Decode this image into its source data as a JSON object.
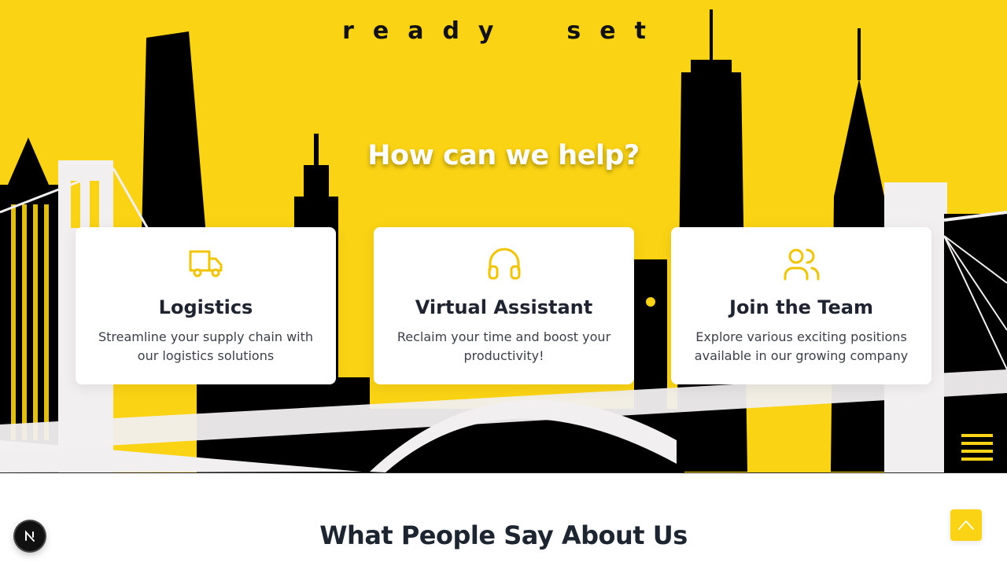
{
  "brand": {
    "logo_text": "ready  set"
  },
  "hero": {
    "title": "How can we help?"
  },
  "colors": {
    "accent": "#fad314",
    "dark": "#111111",
    "card_text": "#3b3f47"
  },
  "services": [
    {
      "icon": "truck-icon",
      "title": "Logistics",
      "description": "Streamline your supply chain with our logistics solutions"
    },
    {
      "icon": "headphones-icon",
      "title": "Virtual Assistant",
      "description": "Reclaim your time and boost your productivity!"
    },
    {
      "icon": "users-icon",
      "title": "Join the Team",
      "description": "Explore various exciting positions available in our growing company"
    }
  ],
  "testimonials": {
    "title": "What People Say About Us"
  },
  "controls": {
    "scroll_top_icon": "chevron-up-icon",
    "dev_badge_icon": "next-logo-icon"
  }
}
